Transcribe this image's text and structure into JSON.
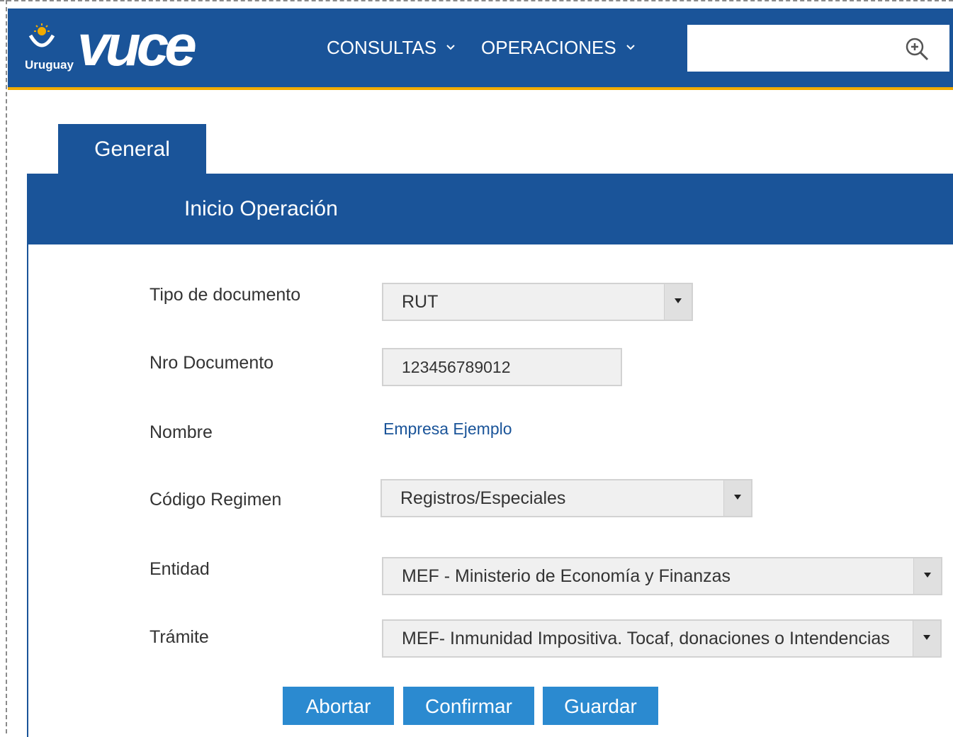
{
  "header": {
    "logo_word": "vuce",
    "logo_country": "Uruguay",
    "nav": [
      {
        "label": "CONSULTAS"
      },
      {
        "label": "OPERACIONES"
      }
    ],
    "search": {
      "value": "",
      "placeholder": ""
    }
  },
  "tabs": [
    {
      "label": "General"
    }
  ],
  "panel": {
    "title": "Inicio Operación"
  },
  "form": {
    "tipo_documento": {
      "label": "Tipo de documento",
      "value": "RUT"
    },
    "nro_documento": {
      "label": "Nro Documento",
      "value": "123456789012"
    },
    "nombre": {
      "label": "Nombre",
      "value": "Empresa Ejemplo"
    },
    "codigo_regimen": {
      "label": "Código Regimen",
      "value": "Registros/Especiales"
    },
    "entidad": {
      "label": "Entidad",
      "value": "MEF - Ministerio de Economía y Finanzas"
    },
    "tramite": {
      "label": "Trámite",
      "value": "MEF- Inmunidad Impositiva. Tocaf, donaciones o Intendencias"
    }
  },
  "buttons": {
    "abort": "Abortar",
    "confirm": "Confirmar",
    "save": "Guardar"
  },
  "colors": {
    "brand_blue": "#1a5499",
    "accent_yellow": "#f0ab00",
    "button_blue": "#2b8ad0"
  }
}
